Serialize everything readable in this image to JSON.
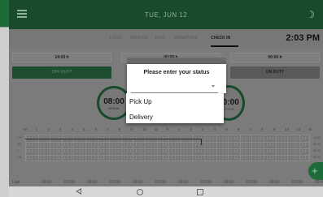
{
  "header": {
    "date": "TUE, JUN 12"
  },
  "tabs": [
    {
      "label": "LOGS"
    },
    {
      "label": "PROFILE"
    },
    {
      "label": "DVIR"
    },
    {
      "label": "SIGNATURE"
    },
    {
      "label": "CHECK IN"
    }
  ],
  "clock": "2:03 PM",
  "time_boxes": [
    "14:03 h",
    "00:00 h",
    "00:00 h"
  ],
  "status": {
    "left": "OFF DUTY",
    "right": "ON DUTY"
  },
  "gauges": {
    "left": {
      "value": "08:00",
      "label": "BREAK"
    },
    "right": {
      "value": "70:00",
      "label": "CYCLE"
    }
  },
  "grid": {
    "hours": [
      "M",
      "1",
      "2",
      "3",
      "4",
      "5",
      "6",
      "7",
      "8",
      "9",
      "10",
      "11",
      "N",
      "1",
      "2",
      "3",
      "4",
      "5",
      "6",
      "7",
      "8",
      "9",
      "10",
      "11",
      "M"
    ],
    "rows": [
      "OFF",
      "SB",
      "D",
      "ON"
    ],
    "totals": [
      "14:03",
      "00:00",
      "00:00",
      "00:00"
    ]
  },
  "summary": [
    "Last",
    "00:00",
    "00:00",
    "00:00",
    "00:00",
    "00:00",
    "00:00",
    "00:00",
    "00:00",
    "00:00",
    "00:00",
    "00:00",
    "00:00",
    "00:00"
  ],
  "dialog": {
    "title": "Please enter your status",
    "options": [
      "Pick Up",
      "Delivery"
    ]
  },
  "fab": "+"
}
